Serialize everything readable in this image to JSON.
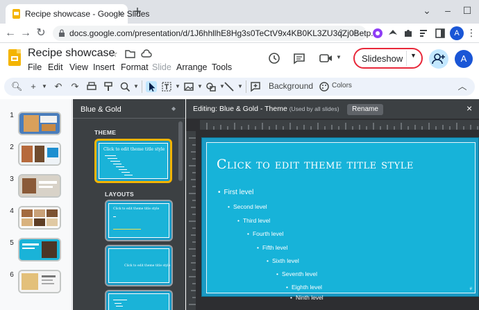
{
  "browser": {
    "tab_title": "Recipe showcase - Google Slides",
    "tab_close": "×",
    "new_tab": "+",
    "url": "docs.google.com/presentation/d/1J6hhllhE8Hg3s0TeCtV9x4KB0KL3ZU3qZj0Betp...",
    "avatar_letter": "A"
  },
  "app": {
    "doc_title": "Recipe showcase",
    "menus": [
      "File",
      "Edit",
      "View",
      "Insert",
      "Format",
      "Slide",
      "Arrange",
      "Tools"
    ],
    "slideshow_label": "Slideshow",
    "avatar_letter": "A",
    "highlight_color": "#e8283a"
  },
  "toolbar": {
    "background_label": "Background",
    "colors_label": "Colors"
  },
  "filmstrip": {
    "slides": [
      {
        "number": "1"
      },
      {
        "number": "2"
      },
      {
        "number": "3"
      },
      {
        "number": "4"
      },
      {
        "number": "5"
      },
      {
        "number": "6"
      }
    ]
  },
  "theme_panel": {
    "theme_name": "Blue & Gold",
    "theme_section": "THEME",
    "layouts_section": "LAYOUTS",
    "theme_thumb_title": "Click to edit theme title style",
    "layout_thumb_title": "Click to edit theme title style",
    "layout_center_title": "Click to edit theme title style"
  },
  "editor": {
    "editing_label": "Editing: Blue & Gold - Theme",
    "used_by": "(Used by all slides)",
    "rename_label": "Rename",
    "close": "×",
    "title": "Click to edit theme title style",
    "levels": [
      "First level",
      "Second level",
      "Third level",
      "Fourth level",
      "Fifth level",
      "Sixth level",
      "Seventh level",
      "Eighth level",
      "Ninth level"
    ],
    "accent_color": "#17b3d9"
  }
}
